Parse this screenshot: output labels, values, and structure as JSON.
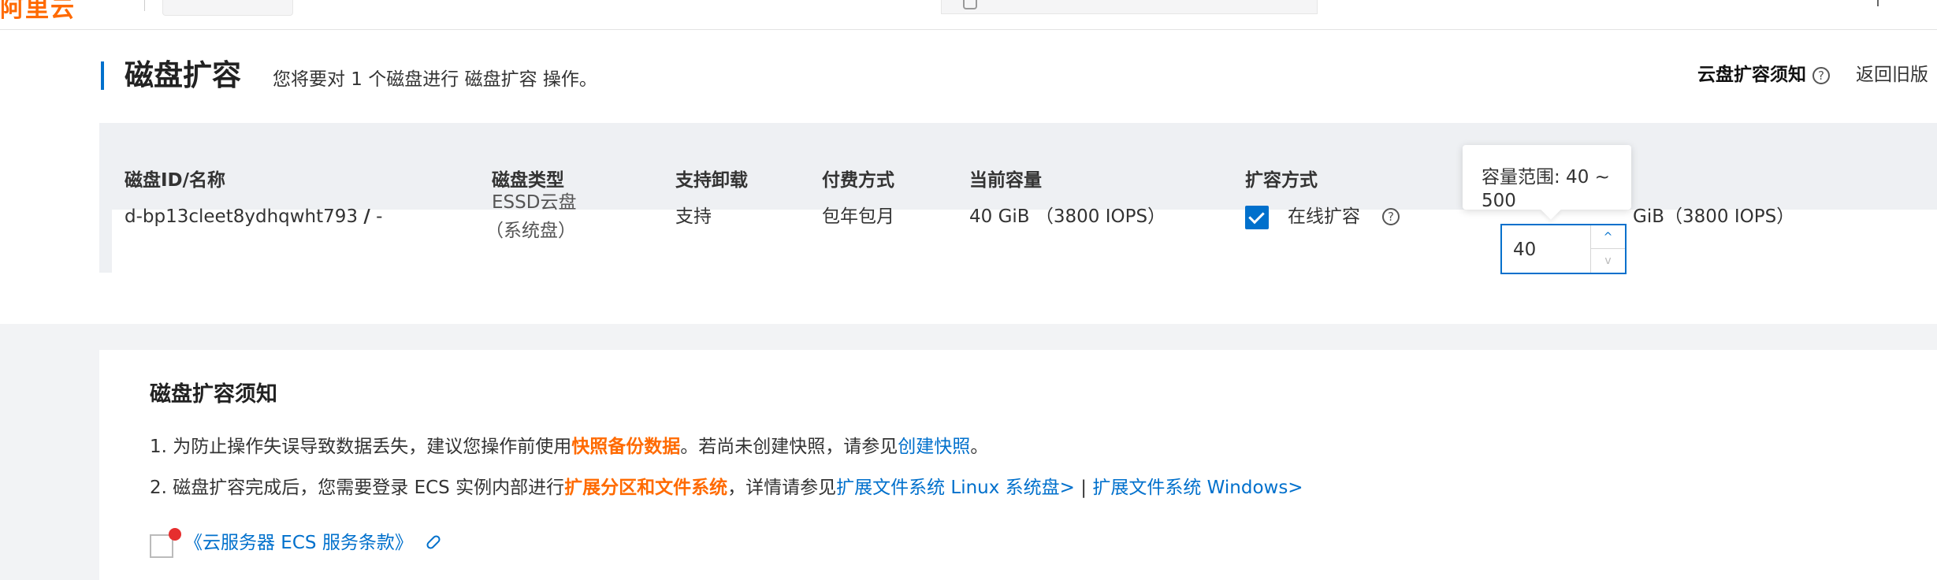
{
  "topnav": {
    "logo_text": "阿里云"
  },
  "header": {
    "title": "磁盘扩容",
    "subtitle": "您将要对 1 个磁盘进行 磁盘扩容 操作。",
    "notice_link": "云盘扩容须知",
    "help_symbol": "?",
    "back_link": "返回旧版"
  },
  "table": {
    "columns": [
      "磁盘ID/名称",
      "磁盘类型",
      "支持卸载",
      "付费方式",
      "当前容量",
      "扩容方式"
    ],
    "row": {
      "disk_id": "d-bp13cleet8ydhqwht793",
      "separator": "/",
      "disk_name": "-",
      "disk_type_line1": "ESSD云盘",
      "disk_type_line2": "（系统盘）",
      "detachable": "支持",
      "billing": "包年包月",
      "current_capacity": "40 GiB （3800 IOPS）",
      "expand_method": "在线扩容",
      "expand_checked": true,
      "new_capacity_value": "40",
      "new_capacity_suffix": "GiB（3800 IOPS）"
    },
    "tooltip": "容量范围: 40 ~ 500",
    "stepper_up": "^",
    "stepper_down": "v"
  },
  "notice": {
    "title": "磁盘扩容须知",
    "line1": {
      "prefix": "1. 为防止操作失误导致数据丢失，建议您操作前使用",
      "highlight": "快照备份数据",
      "middle": "。若尚未创建快照，请参见",
      "link": "创建快照",
      "suffix": "。"
    },
    "line2": {
      "prefix": "2. 磁盘扩容完成后，您需要登录 ECS 实例内部进行",
      "highlight": "扩展分区和文件系统",
      "middle": "，详情请参见",
      "link1": "扩展文件系统 Linux 系统盘>",
      "separator": " | ",
      "link2": "扩展文件系统 Windows>"
    },
    "agreement_link": "《云服务器 ECS 服务条款》"
  },
  "colors": {
    "brand_orange": "#ff6a00",
    "primary_blue": "#0070cc",
    "required_red": "#e62e2e"
  }
}
